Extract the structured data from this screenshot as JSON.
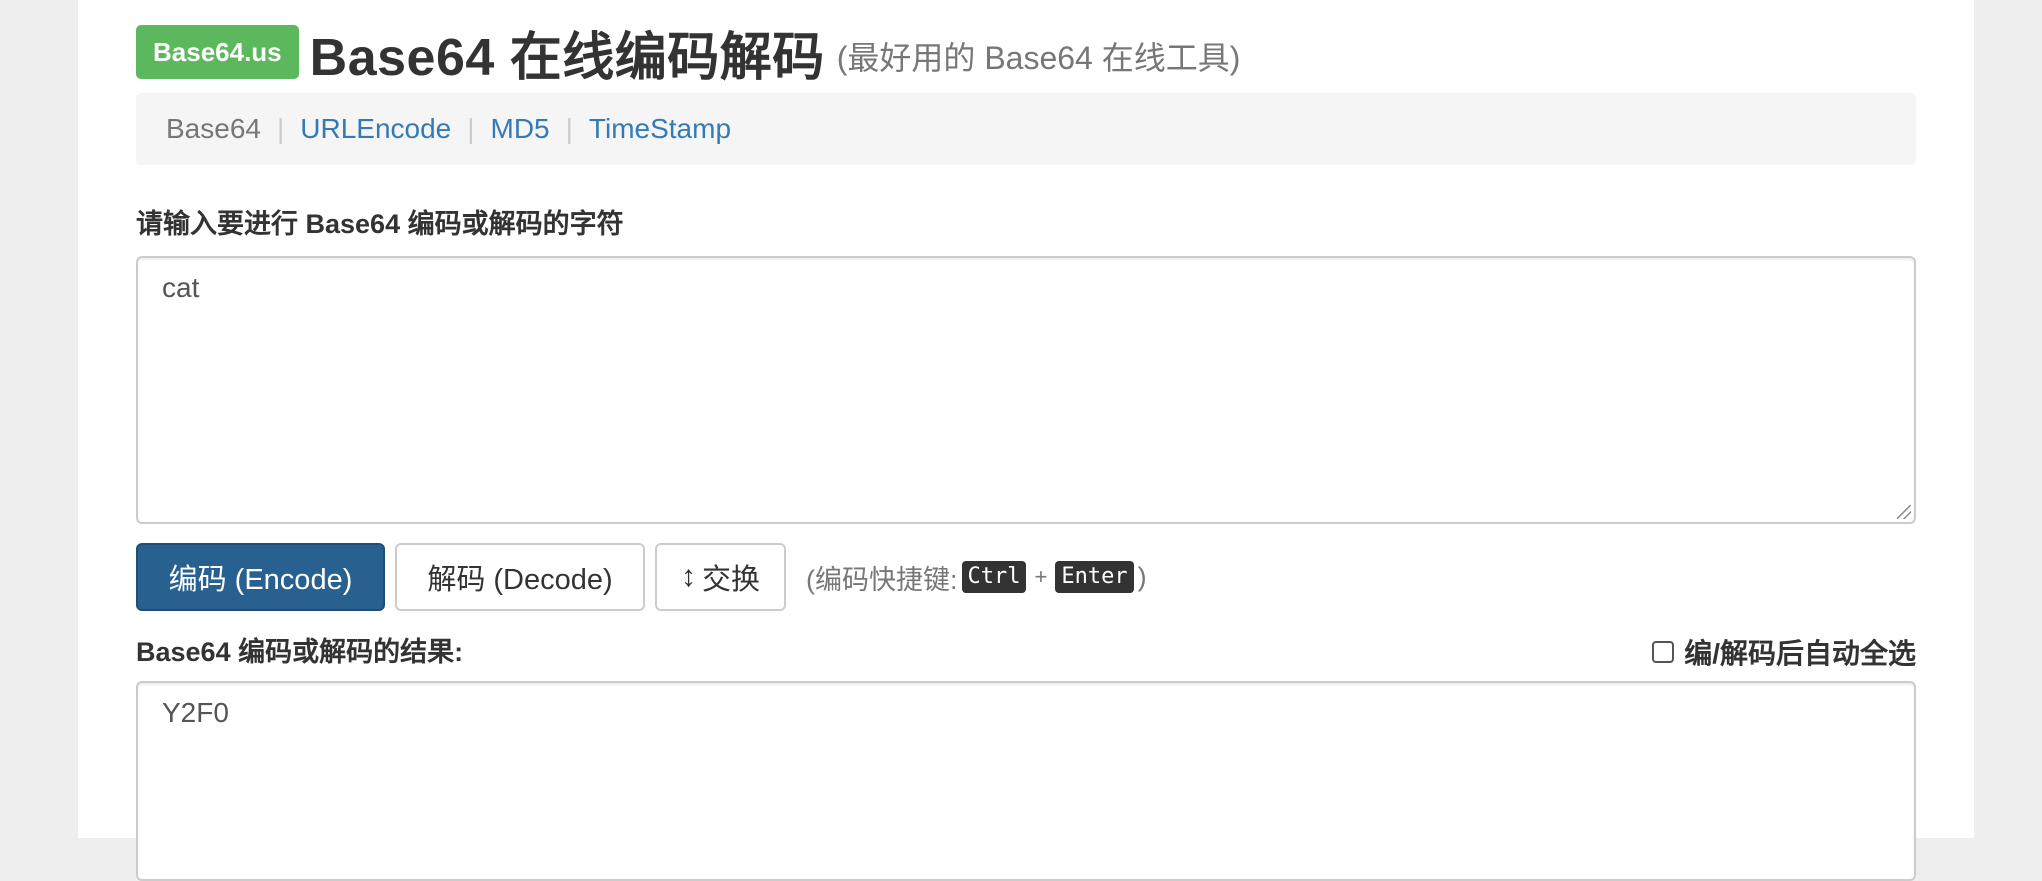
{
  "header": {
    "logo": "Base64.us",
    "title": "Base64 在线编码解码",
    "subtitle": "(最好用的 Base64 在线工具)"
  },
  "nav": {
    "items": [
      {
        "label": "Base64",
        "active": true
      },
      {
        "label": "URLEncode",
        "active": false
      },
      {
        "label": "MD5",
        "active": false
      },
      {
        "label": "TimeStamp",
        "active": false
      }
    ],
    "separator": "|"
  },
  "input": {
    "label": "请输入要进行 Base64 编码或解码的字符",
    "value": "cat"
  },
  "buttons": {
    "encode": "编码 (Encode)",
    "decode": "解码 (Decode)",
    "swap": "交换",
    "swap_icon": "↕"
  },
  "shortcut": {
    "prefix": "(编码快捷键:",
    "key1": "Ctrl",
    "plus": "+",
    "key2": "Enter",
    "suffix": ")"
  },
  "result": {
    "label": "Base64 编码或解码的结果:",
    "value": "Y2F0"
  },
  "auto_select": {
    "label": "编/解码后自动全选",
    "checked": false
  },
  "colors": {
    "logo_bg": "#5cb85c",
    "primary_button": "#286090",
    "link": "#337ab7"
  }
}
